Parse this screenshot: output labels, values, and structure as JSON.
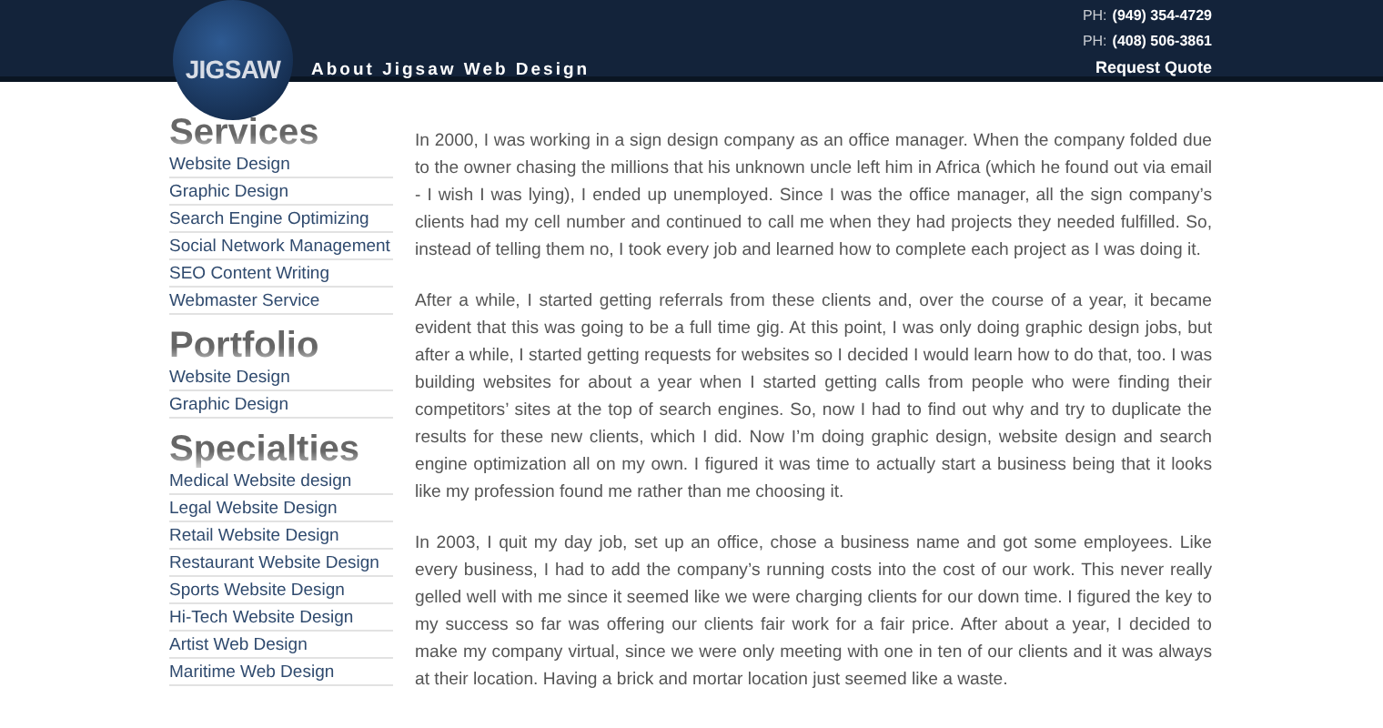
{
  "header": {
    "logo": "JIGSAW",
    "title": "About Jigsaw Web Design",
    "phones": [
      {
        "label": "PH:",
        "number": "(949) 354-4729"
      },
      {
        "label": "PH:",
        "number": "(408) 506-3861"
      }
    ],
    "cta": "Request Quote"
  },
  "sidebar": [
    {
      "heading": "Services",
      "items": [
        "Website Design",
        "Graphic Design",
        "Search Engine Optimizing",
        "Social Network Management",
        "SEO Content Writing",
        "Webmaster Service"
      ]
    },
    {
      "heading": "Portfolio",
      "items": [
        "Website Design",
        "Graphic Design"
      ]
    },
    {
      "heading": "Specialties",
      "items": [
        "Medical Website design",
        "Legal Website Design",
        "Retail Website Design",
        "Restaurant Website Design",
        "Sports Website Design",
        "Hi-Tech Website Design",
        "Artist Web Design",
        "Maritime Web Design"
      ]
    }
  ],
  "paragraphs": [
    "In 2000, I was working in a sign design company as an office manager. When the company folded due to the owner chasing the millions that his unknown uncle left him in Africa (which he found out via email - I wish I was lying), I ended up unemployed. Since I was the office manager, all the sign company’s clients had my cell number and continued to call me when they had projects they needed fulfilled. So, instead of telling them no, I took every job and learned how to complete each project as I was doing it.",
    "After a while, I started getting referrals from these clients and, over the course of a year, it became evident that this was going to be a full time gig. At this point, I was only doing graphic design jobs, but after a while, I started getting requests for websites so I decided I would learn how to do that, too. I was building websites for about a year when I started getting calls from people who were finding their competitors’ sites at the top of search engines. So, now I had to find out why and try to duplicate the results for these new clients, which I did. Now I’m doing graphic design, website design and search engine optimization all on my own. I figured it was time to actually start a business being that it looks like my profession found me rather than me choosing it.",
    "In 2003, I quit my day job, set up an office, chose a business name and got some employees. Like every business, I had to add the company’s running costs into the cost of our work. This never really gelled well with me since it seemed like we were charging clients for our down time. I figured the key to my success so far was offering our clients fair work for a fair price. After about a year, I decided to make my company virtual, since we were only meeting with one in ten of our clients and it was always at their location. Having a brick and mortar location just seemed like a waste."
  ]
}
